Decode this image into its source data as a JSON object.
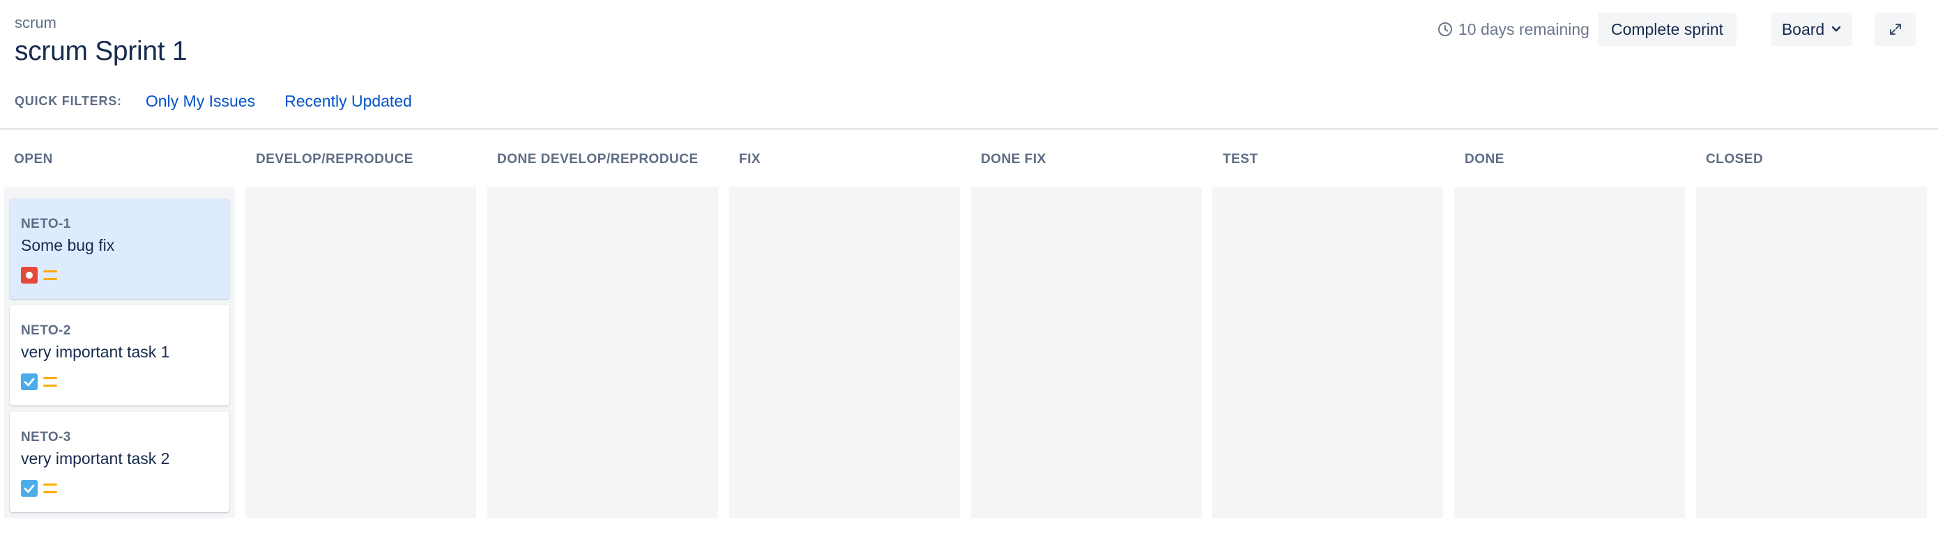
{
  "project": "scrum",
  "sprint_title": "scrum Sprint 1",
  "quick_filters": {
    "label": "QUICK FILTERS:",
    "items": [
      "Only My Issues",
      "Recently Updated"
    ]
  },
  "toolbar": {
    "remaining": "10 days remaining",
    "complete_label": "Complete sprint",
    "board_label": "Board",
    "clock_icon": "clock-icon",
    "expand_icon": "expand-icon"
  },
  "columns": [
    "OPEN",
    "DEVELOP/REPRODUCE",
    "DONE DEVELOP/REPRODUCE",
    "FIX",
    "DONE FIX",
    "TEST",
    "DONE",
    "CLOSED"
  ],
  "cards": [
    {
      "key": "NETO-1",
      "summary": "Some bug fix",
      "type": "bug",
      "priority": "medium",
      "selected": true
    },
    {
      "key": "NETO-2",
      "summary": "very important task 1",
      "type": "task",
      "priority": "medium",
      "selected": false
    },
    {
      "key": "NETO-3",
      "summary": "very important task 2",
      "type": "task",
      "priority": "medium",
      "selected": false
    }
  ],
  "colors": {
    "bug": "#e5493a",
    "task": "#4bade8",
    "priority_medium": "#ffab00",
    "link": "#0052cc",
    "selected_card": "#deebff",
    "lane": "#f4f5f7"
  }
}
